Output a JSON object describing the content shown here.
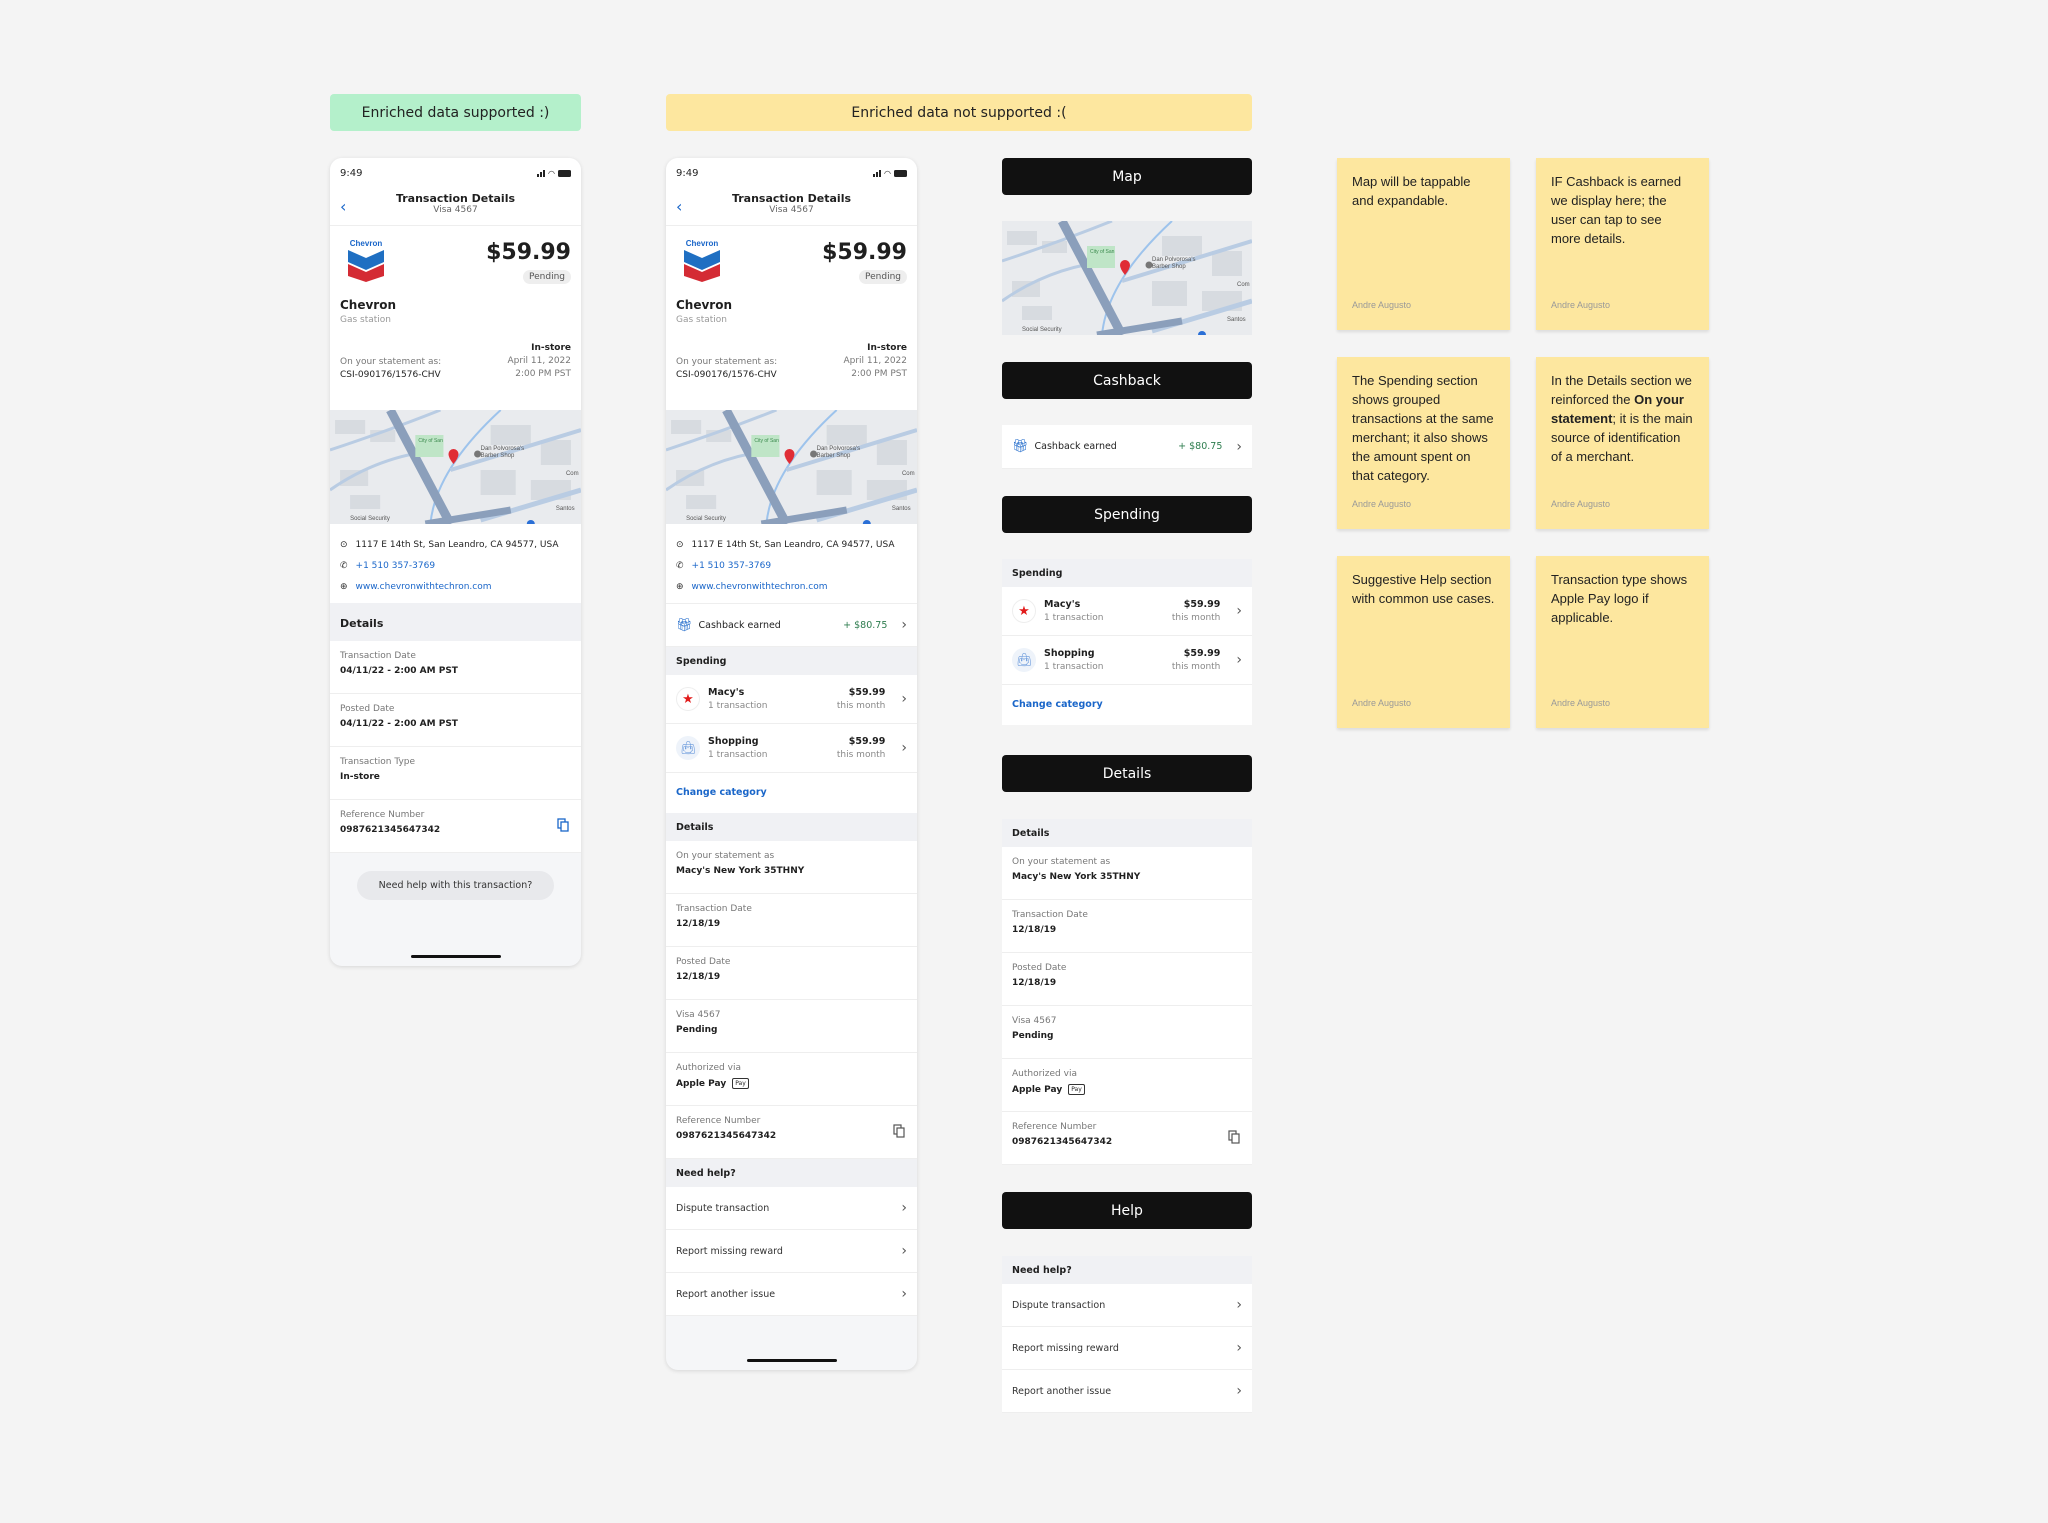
{
  "labels": {
    "supported": "Enriched data supported :)",
    "not_supported": "Enriched data not supported :("
  },
  "phone": {
    "time": "9:49",
    "title": "Transaction Details",
    "subtitle": "Visa 4567",
    "logo_text": "Chevron",
    "amount": "$59.99",
    "status": "Pending",
    "merchant": "Chevron",
    "category": "Gas station",
    "type": "In-store",
    "statement_label": "On your statement as:",
    "statement_value": "CSI-090176/1576-CHV",
    "date": "April 11, 2022",
    "time_of_txn": "2:00 PM PST",
    "address": "1117 E 14th St, San Leandro, CA 94577, USA",
    "phone_number": "+1 510 357-3769",
    "website": "www.chevronwithtechron.com"
  },
  "map_labels": {
    "park": "City of San Leandro Root Park",
    "shop": "Dan Polvorosa's Barber Shop",
    "street1": "Arroyo Ave",
    "social": "Social Security",
    "santos": "Santos F Mortuary",
    "com": "Com"
  },
  "phone1_details": {
    "header": "Details",
    "rows": [
      {
        "label": "Transaction Date",
        "value": "04/11/22 - 2:00 AM PST"
      },
      {
        "label": "Posted Date",
        "value": "04/11/22 - 2:00 AM PST"
      },
      {
        "label": "Transaction Type",
        "value": "In-store"
      },
      {
        "label": "Reference Number",
        "value": "0987621345647342"
      }
    ],
    "help_button": "Need help with this transaction?"
  },
  "cashback": {
    "label": "Cashback earned",
    "amount": "+ $80.75"
  },
  "spending": {
    "header": "Spending",
    "items": [
      {
        "name": "Macy's",
        "sub": "1 transaction",
        "amount": "$59.99",
        "period": "this month",
        "icon": "macys-star-icon"
      },
      {
        "name": "Shopping",
        "sub": "1 transaction",
        "amount": "$59.99",
        "period": "this month",
        "icon": "shopping-bag-icon"
      }
    ],
    "change_category": "Change category"
  },
  "details2": {
    "header": "Details",
    "rows": [
      {
        "label": "On your statement as",
        "value": "Macy's New York 35THNY"
      },
      {
        "label": "Transaction Date",
        "value": "12/18/19"
      },
      {
        "label": "Posted Date",
        "value": "12/18/19"
      },
      {
        "label": "Visa 4567",
        "value": "Pending"
      },
      {
        "label": "Authorized via",
        "value": "Apple Pay",
        "badge": "Pay"
      },
      {
        "label": "Reference Number",
        "value": "0987621345647342"
      }
    ]
  },
  "help": {
    "header": "Need help?",
    "items": [
      "Dispute transaction",
      "Report missing reward",
      "Report another issue"
    ]
  },
  "sections": {
    "map": "Map",
    "cashback": "Cashback",
    "spending": "Spending",
    "details": "Details",
    "help": "Help"
  },
  "notes": [
    {
      "text": "Map will be tappable and expandable.",
      "author": "Andre Augusto"
    },
    {
      "text": "IF Cashback is earned we display here; the user can tap to see more details.",
      "author": "Andre Augusto"
    },
    {
      "text": "The Spending section shows grouped transactions at the same merchant; it also shows the amount spent on that category.",
      "author": "Andre Augusto"
    },
    {
      "text_before": "In the Details section we reinforced the ",
      "text_bold": "On your statement",
      "text_after": "; it is the main source of identification of a merchant.",
      "author": "Andre Augusto"
    },
    {
      "text": "Suggestive Help section with common use cases.",
      "author": "Andre Augusto"
    },
    {
      "text": "Transaction type shows Apple Pay logo if applicable.",
      "author": "Andre Augusto"
    }
  ],
  "colors": {
    "link": "#1a66c9",
    "cashback_green": "#2e7d4f",
    "note": "#fde79f",
    "supported": "#b4f0cb"
  }
}
